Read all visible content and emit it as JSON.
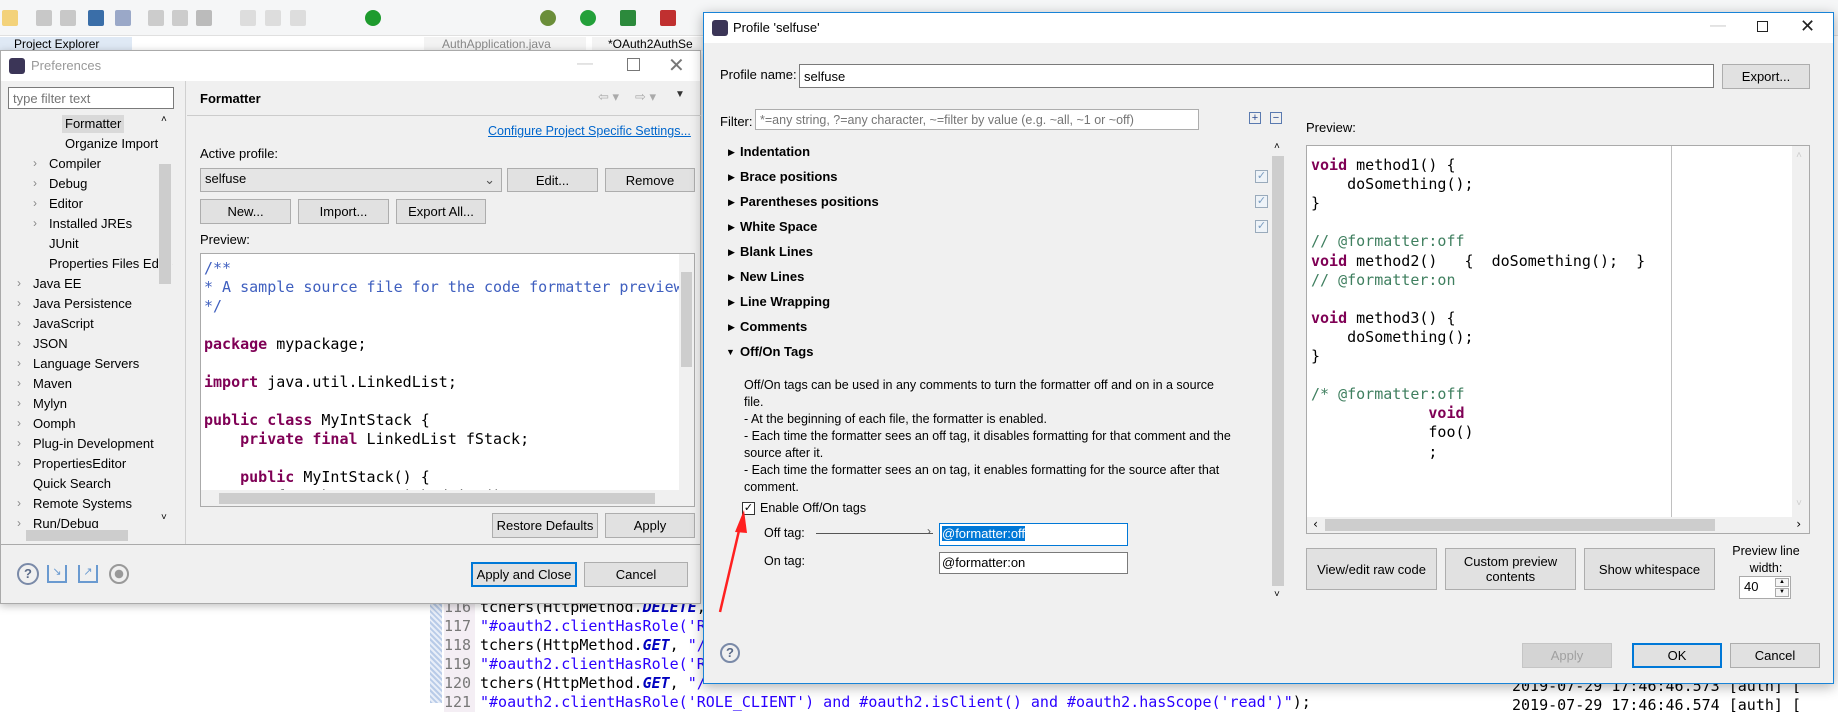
{
  "background": {
    "tabs": [
      "Project Explorer",
      "AuthApplication.java",
      "*OAuth2AuthSe"
    ],
    "editor_lines": [
      {
        "num": "116",
        "tokens": [
          [
            "",
            "tchers(HttpMethod."
          ],
          [
            "cst",
            "DELETE"
          ],
          [
            "",
            ","
          ]
        ]
      },
      {
        "num": "117",
        "tokens": [
          [
            "str",
            "\"#oauth2.clientHasRole('R"
          ]
        ]
      },
      {
        "num": "118",
        "tokens": [
          [
            "",
            "tchers(HttpMethod."
          ],
          [
            "cst",
            "GET"
          ],
          [
            "",
            ", "
          ],
          [
            "str",
            "\"/"
          ]
        ]
      },
      {
        "num": "119",
        "tokens": [
          [
            "str",
            "\"#oauth2.clientHasRole('R"
          ]
        ]
      },
      {
        "num": "120",
        "tokens": [
          [
            "",
            "tchers(HttpMethod."
          ],
          [
            "cst",
            "GET"
          ],
          [
            "",
            ", "
          ],
          [
            "str",
            "\"/"
          ]
        ]
      },
      {
        "num": "121",
        "tokens": [
          [
            "str",
            "\"#oauth2.clientHasRole('ROLE_CLIENT') and #oauth2.isClient() and #oauth2.hasScope('read')\""
          ],
          [
            "",
            ");"
          ]
        ]
      }
    ],
    "console_lines": [
      "2019-07-29 17:46:46.573 [auth] [",
      "2019-07-29 17:46:46.574 [auth] ["
    ]
  },
  "preferences": {
    "title": "Preferences",
    "filter_placeholder": "type filter text",
    "tree": [
      {
        "label": "Formatter",
        "level": 2,
        "arrow": false,
        "selected": true
      },
      {
        "label": "Organize Imports",
        "level": 2,
        "arrow": false
      },
      {
        "label": "Compiler",
        "level": 1,
        "arrow": true
      },
      {
        "label": "Debug",
        "level": 1,
        "arrow": true
      },
      {
        "label": "Editor",
        "level": 1,
        "arrow": true
      },
      {
        "label": "Installed JREs",
        "level": 1,
        "arrow": true
      },
      {
        "label": "JUnit",
        "level": 1,
        "arrow": false
      },
      {
        "label": "Properties Files Editor",
        "level": 1,
        "arrow": false
      },
      {
        "label": "Java EE",
        "level": 0,
        "arrow": true
      },
      {
        "label": "Java Persistence",
        "level": 0,
        "arrow": true
      },
      {
        "label": "JavaScript",
        "level": 0,
        "arrow": true
      },
      {
        "label": "JSON",
        "level": 0,
        "arrow": true
      },
      {
        "label": "Language Servers",
        "level": 0,
        "arrow": true
      },
      {
        "label": "Maven",
        "level": 0,
        "arrow": true
      },
      {
        "label": "Mylyn",
        "level": 0,
        "arrow": true
      },
      {
        "label": "Oomph",
        "level": 0,
        "arrow": true
      },
      {
        "label": "Plug-in Development",
        "level": 0,
        "arrow": true
      },
      {
        "label": "PropertiesEditor",
        "level": 0,
        "arrow": true
      },
      {
        "label": "Quick Search",
        "level": 0,
        "arrow": false
      },
      {
        "label": "Remote Systems",
        "level": 0,
        "arrow": true
      },
      {
        "label": "Run/Debug",
        "level": 0,
        "arrow": true
      }
    ],
    "page_title": "Formatter",
    "configure_link": "Configure Project Specific Settings...",
    "active_profile_label": "Active profile:",
    "active_profile_value": "selfuse",
    "edit_button": "Edit...",
    "remove_button": "Remove",
    "new_button": "New...",
    "import_button": "Import...",
    "export_all_button": "Export All...",
    "preview_label": "Preview:",
    "preview_code": [
      [
        [
          "jd",
          "/**"
        ]
      ],
      [
        [
          "jd",
          "* A sample source file for the code formatter preview"
        ]
      ],
      [
        [
          "jd",
          "*/"
        ]
      ],
      [],
      [
        [
          "kw",
          "package"
        ],
        [
          "",
          " mypackage;"
        ]
      ],
      [],
      [
        [
          "kw",
          "import"
        ],
        [
          "",
          " java.util.LinkedList;"
        ]
      ],
      [],
      [
        [
          "kw",
          "public"
        ],
        [
          "",
          " "
        ],
        [
          "kw",
          "class"
        ],
        [
          "",
          " MyIntStack {"
        ]
      ],
      [
        [
          "",
          "    "
        ],
        [
          "kw",
          "private"
        ],
        [
          "",
          " "
        ],
        [
          "kw",
          "final"
        ],
        [
          "",
          " LinkedList fStack;"
        ]
      ],
      [],
      [
        [
          "",
          "    "
        ],
        [
          "kw",
          "public"
        ],
        [
          "",
          " MyIntStack() {"
        ]
      ],
      [
        [
          "",
          "        fStack = new LinkedList();"
        ]
      ]
    ],
    "restore_defaults_button": "Restore Defaults",
    "apply_button": "Apply",
    "apply_close_button": "Apply and Close",
    "cancel_button": "Cancel"
  },
  "profile": {
    "title": "Profile 'selfuse'",
    "name_label": "Profile name:",
    "name_value": "selfuse",
    "export_button": "Export...",
    "filter_label": "Filter:",
    "filter_placeholder": "*=any string, ?=any character, ~=filter by value (e.g. ~all, ~1 or ~off)",
    "sections": [
      {
        "label": "Indentation",
        "expanded": false,
        "modified": false
      },
      {
        "label": "Brace positions",
        "expanded": false,
        "modified": true
      },
      {
        "label": "Parentheses positions",
        "expanded": false,
        "modified": true
      },
      {
        "label": "White Space",
        "expanded": false,
        "modified": true
      },
      {
        "label": "Blank Lines",
        "expanded": false,
        "modified": false
      },
      {
        "label": "New Lines",
        "expanded": false,
        "modified": false
      },
      {
        "label": "Line Wrapping",
        "expanded": false,
        "modified": false
      },
      {
        "label": "Comments",
        "expanded": false,
        "modified": false
      },
      {
        "label": "Off/On Tags",
        "expanded": true,
        "modified": false
      }
    ],
    "description": [
      "Off/On tags can be used in any comments to turn the formatter off and on in a source",
      "file.",
      "- At the beginning of each file, the formatter is enabled.",
      "- Each time the formatter sees an off tag, it disables formatting for that comment and the",
      "source after it.",
      "- Each time the formatter sees an on tag, it enables formatting for the source after that",
      "comment."
    ],
    "enable_label": "Enable Off/On tags",
    "enable_checked": true,
    "off_tag_label": "Off tag:",
    "off_tag_value": "@formatter:off",
    "on_tag_label": "On tag:",
    "on_tag_value": "@formatter:on",
    "preview_label": "Preview:",
    "preview_code": [
      [
        [
          "kw",
          "void"
        ],
        [
          "",
          " method1() {"
        ]
      ],
      [
        [
          "",
          "    doSomething();"
        ]
      ],
      [
        [
          "",
          "}"
        ]
      ],
      [],
      [
        [
          "cm",
          "// @formatter:off"
        ]
      ],
      [
        [
          "kw",
          "void"
        ],
        [
          "",
          " method2()   {  doSomething();  }"
        ]
      ],
      [
        [
          "cm",
          "// @formatter:on"
        ]
      ],
      [],
      [
        [
          "kw",
          "void"
        ],
        [
          "",
          " method3() {"
        ]
      ],
      [
        [
          "",
          "    doSomething();"
        ]
      ],
      [
        [
          "",
          "}"
        ]
      ],
      [],
      [
        [
          "cm",
          "/* @formatter:off"
        ]
      ],
      [
        [
          "",
          "             "
        ],
        [
          "kw",
          "void"
        ]
      ],
      [
        [
          "",
          "             foo()"
        ]
      ],
      [
        [
          "",
          "             ;"
        ]
      ]
    ],
    "view_raw_button": "View/edit raw code",
    "custom_preview_button_line1": "Custom preview",
    "custom_preview_button_line2": "contents",
    "show_whitespace_button": "Show whitespace",
    "line_width_label_line1": "Preview line",
    "line_width_label_line2": "width:",
    "line_width_value": "40",
    "apply_button": "Apply",
    "ok_button": "OK",
    "cancel_button": "Cancel"
  },
  "colors": {
    "accent": "#0078d7",
    "annotation_arrow": "#ff2020",
    "dialog_bg": "#f0f0f0"
  }
}
